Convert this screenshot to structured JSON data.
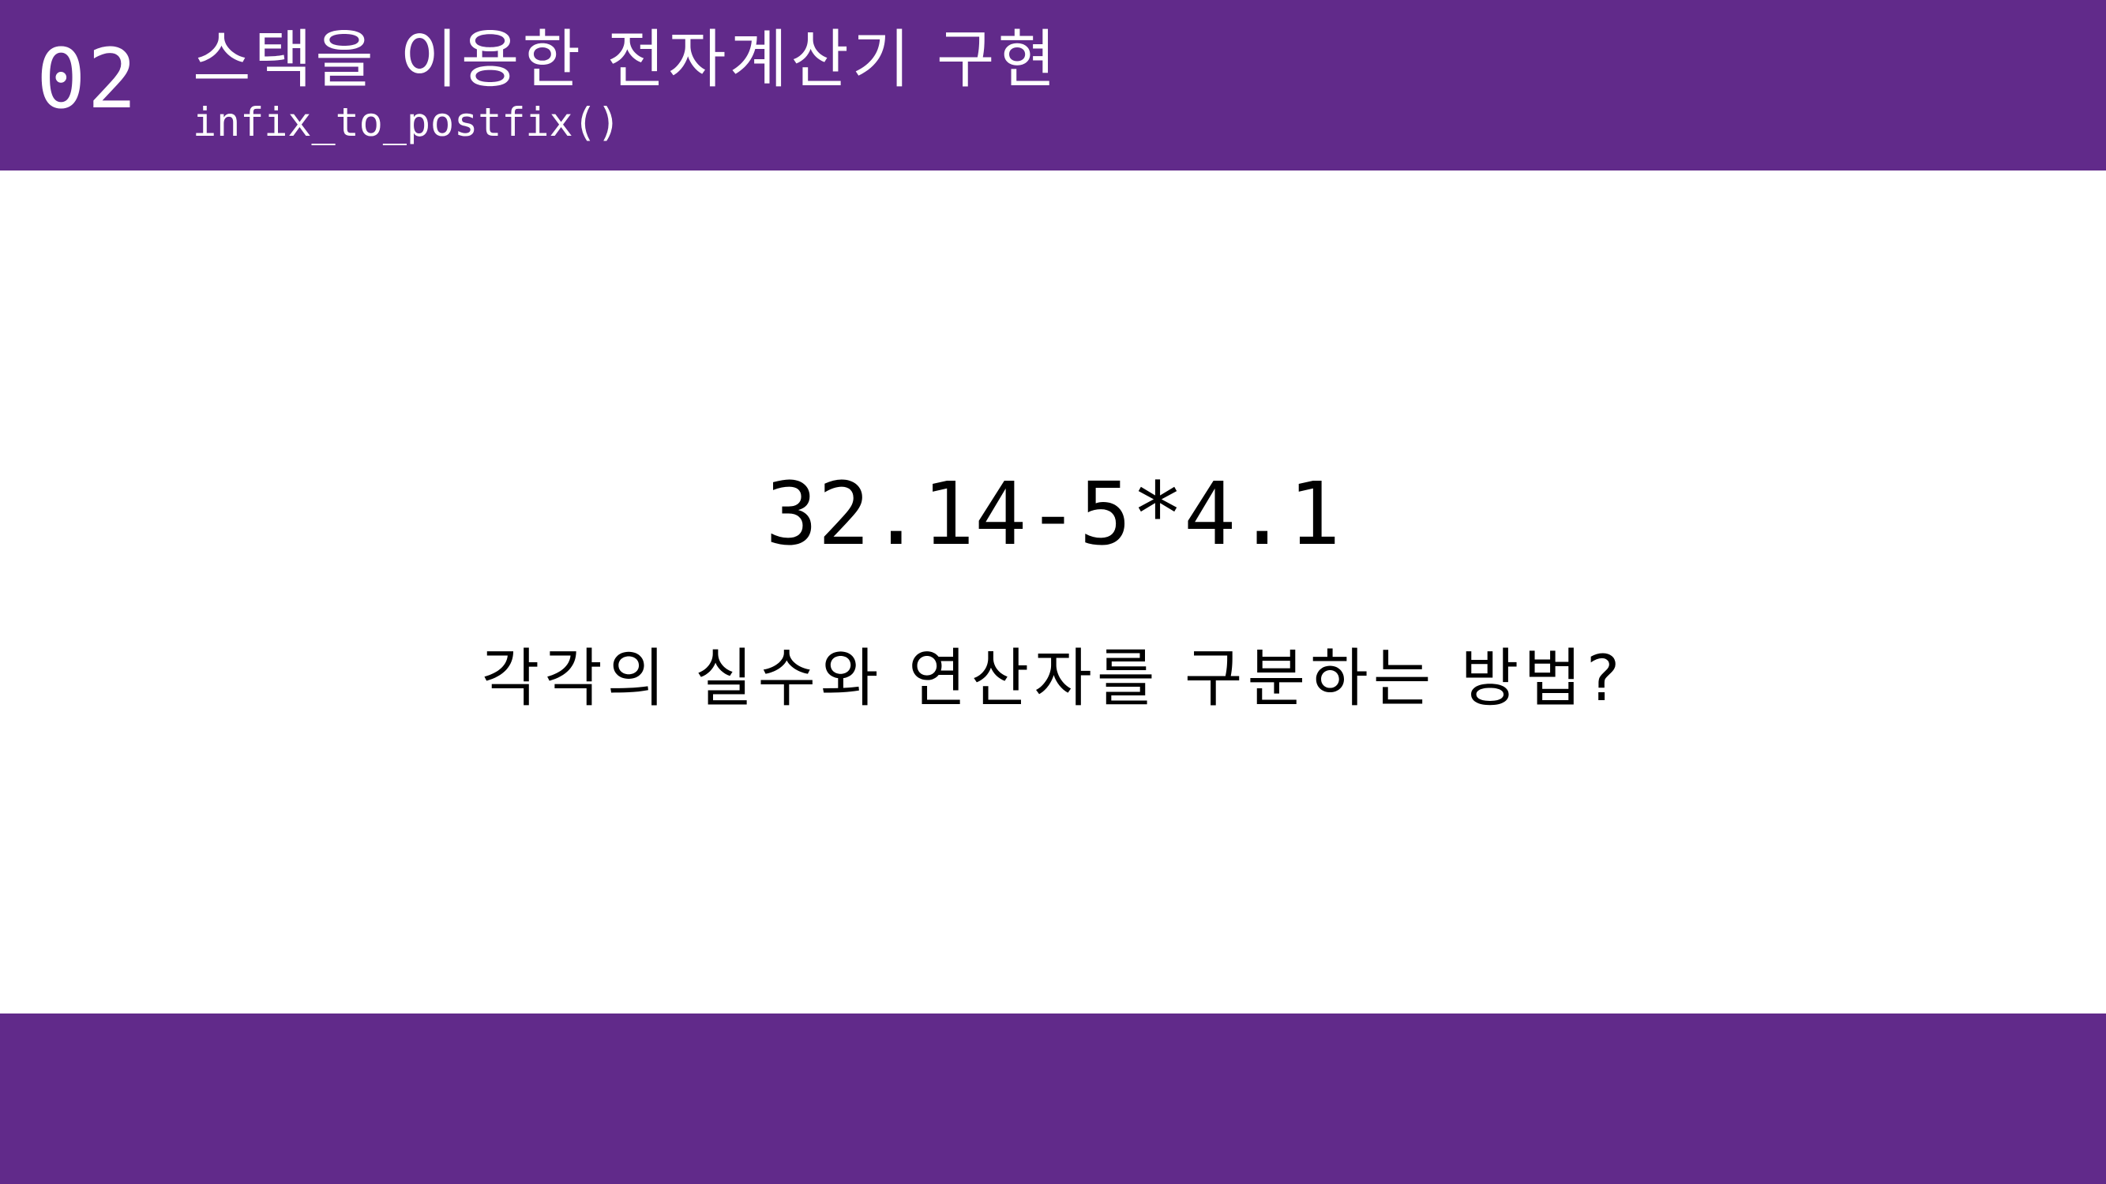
{
  "header": {
    "section_number": "02",
    "title": "스택을 이용한 전자계산기 구현",
    "subtitle": "infix_to_postfix()"
  },
  "main": {
    "expression": "32.14-5*4.1",
    "question": "각각의 실수와 연산자를 구분하는 방법?"
  },
  "colors": {
    "accent": "#612a8a",
    "background": "#ffffff",
    "text": "#000000",
    "header_text": "#ffffff"
  }
}
